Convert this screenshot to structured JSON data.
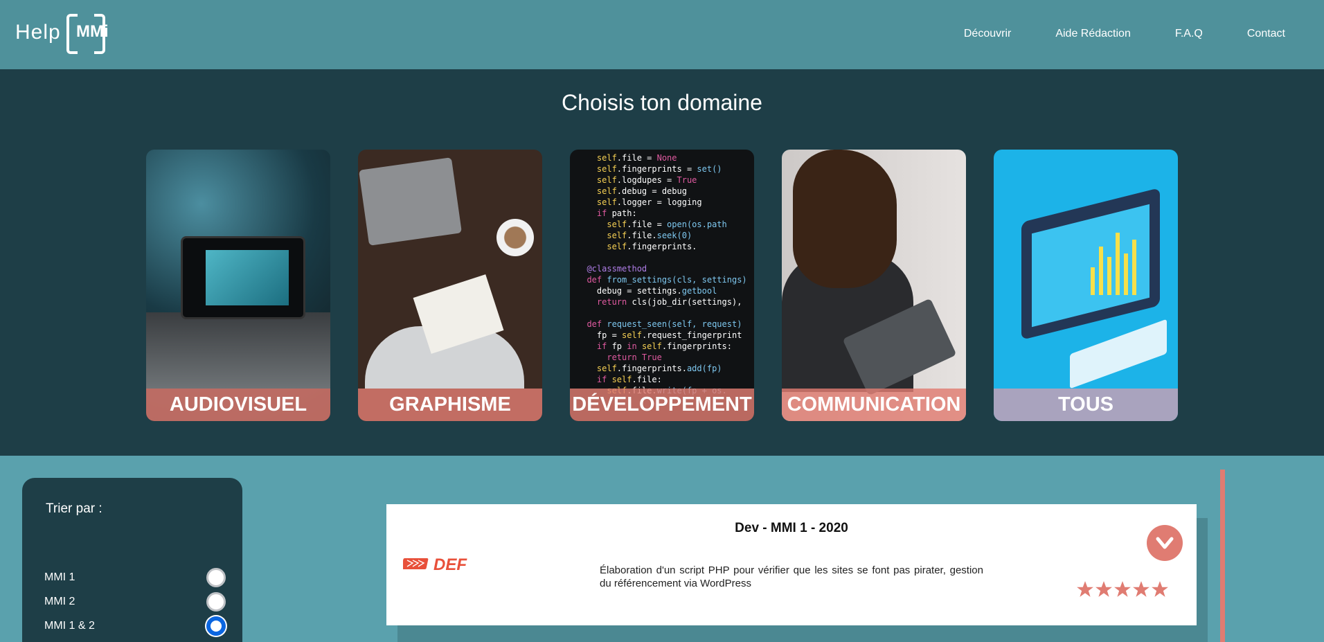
{
  "header": {
    "logo": {
      "help": "Help",
      "mmi": "MMi"
    },
    "nav": [
      "Découvrir",
      "Aide Rédaction",
      "F.A.Q",
      "Contact"
    ]
  },
  "domains": {
    "title": "Choisis ton domaine",
    "cards": [
      {
        "label": "AUDIOVISUEL"
      },
      {
        "label": "GRAPHISME"
      },
      {
        "label": "DÉVELOPPEMENT"
      },
      {
        "label": "COMMUNICATION"
      },
      {
        "label": "TOUS"
      }
    ]
  },
  "sort": {
    "title": "Trier par :",
    "options": [
      "MMI 1",
      "MMI 2",
      "MMI 1 & 2"
    ],
    "selected": "MMI 1 & 2"
  },
  "offer": {
    "title": "Dev - MMI 1 - 2020",
    "company": "DEF",
    "description": "Élaboration d'un script PHP pour vérifier que les sites se font pas pirater, gestion du référencement via WordPress",
    "rating": 5
  },
  "colors": {
    "header": "#4f919b",
    "band": "#1e3e47",
    "accent": "#e07c72",
    "body": "#5aa1ad"
  }
}
